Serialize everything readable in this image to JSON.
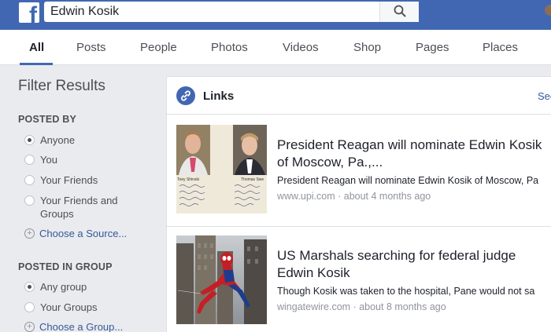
{
  "header": {
    "logo_letter": "f",
    "search_value": "Edwin Kosik"
  },
  "tabs": [
    {
      "label": "All",
      "active": true
    },
    {
      "label": "Posts"
    },
    {
      "label": "People"
    },
    {
      "label": "Photos"
    },
    {
      "label": "Videos"
    },
    {
      "label": "Shop"
    },
    {
      "label": "Pages"
    },
    {
      "label": "Places"
    }
  ],
  "filters": {
    "title": "Filter Results",
    "posted_by": {
      "heading": "POSTED BY",
      "options": [
        {
          "label": "Anyone",
          "checked": true
        },
        {
          "label": "You"
        },
        {
          "label": "Your Friends"
        },
        {
          "label": "Your Friends and",
          "label2": "Groups"
        }
      ],
      "choose": "Choose a Source..."
    },
    "posted_in_group": {
      "heading": "POSTED IN GROUP",
      "options": [
        {
          "label": "Any group",
          "checked": true
        },
        {
          "label": "Your Groups"
        }
      ],
      "choose": "Choose a Group..."
    }
  },
  "links": {
    "title": "Links",
    "see_all": "See All",
    "results": [
      {
        "title_line1": "President Reagan will nominate Edwin Kosik",
        "title_line2": "of Moscow, Pa.,...",
        "description": "President Reagan will nominate Edwin Kosik of Moscow, Pa",
        "source": "www.upi.com",
        "time": "about 4 months ago",
        "thumb_caption_left": "Toey Shinski",
        "thumb_caption_right": "Thomas Swe"
      },
      {
        "title_line1": "US Marshals searching for federal judge",
        "title_line2": "Edwin Kosik",
        "description": "Though Kosik was taken to the hospital, Pane would not sa",
        "source": "wingatewire.com",
        "time": "about 8 months ago"
      }
    ]
  },
  "colors": {
    "brand_blue": "#4267b2",
    "link_blue": "#365899",
    "bg": "#e9ebee"
  }
}
